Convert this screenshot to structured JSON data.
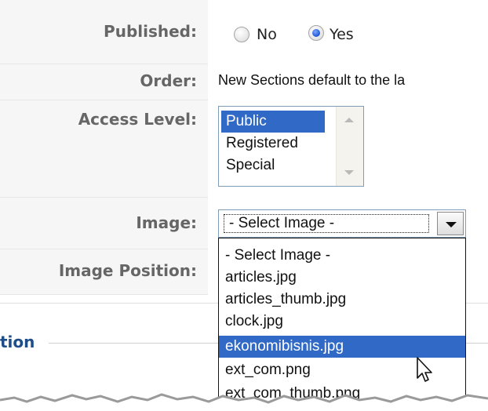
{
  "form": {
    "published": {
      "label": "Published:",
      "options": [
        "No",
        "Yes"
      ],
      "selected": "Yes"
    },
    "order": {
      "label": "Order:",
      "text": "New Sections default to the la"
    },
    "access_level": {
      "label": "Access Level:",
      "options": [
        "Public",
        "Registered",
        "Special"
      ],
      "selected": "Public"
    },
    "image": {
      "label": "Image:",
      "selected_value": "- Select Image -",
      "options": [
        "- Select Image -",
        "articles.jpg",
        "articles_thumb.jpg",
        "clock.jpg",
        "ekonomibisnis.jpg",
        "ext_com.png",
        "ext_com_thumb.png"
      ],
      "highlighted": "ekonomibisnis.jpg"
    },
    "image_position": {
      "label": "Image Position:"
    }
  },
  "section": {
    "title_fragment": "tion"
  },
  "icons": {
    "cursor": "arrow-cursor-icon",
    "dropdown": "chevron-down-icon"
  },
  "colors": {
    "selection": "#3169c6",
    "label_bg": "#f6f6f6",
    "section_title": "#1f4d8a"
  }
}
